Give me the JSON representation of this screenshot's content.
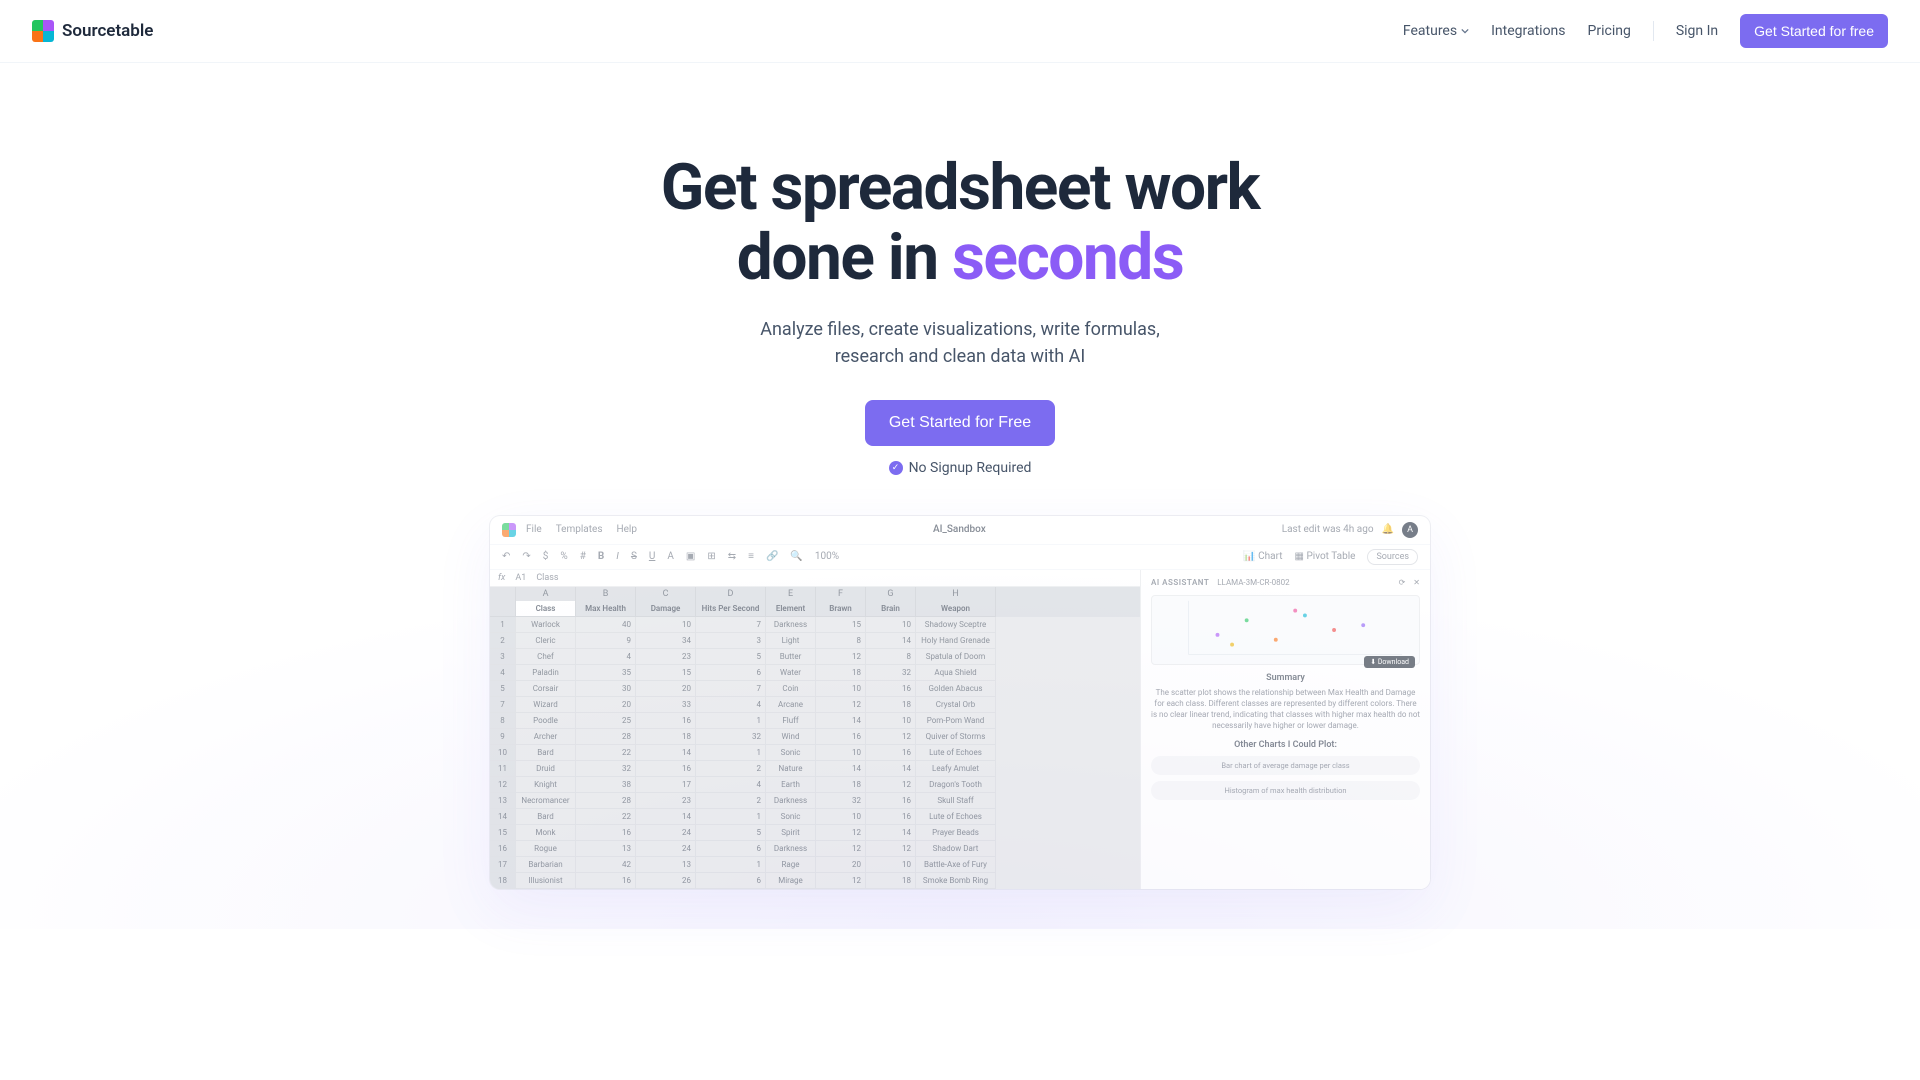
{
  "brand": "Sourcetable",
  "nav": {
    "features": "Features",
    "integrations": "Integrations",
    "pricing": "Pricing",
    "signin": "Sign In",
    "cta": "Get Started for free"
  },
  "hero": {
    "line1a": "Get spreadsheet work",
    "line2a": "done in ",
    "line2b": "seconds",
    "sub1": "Analyze files, create visualizations, write formulas,",
    "sub2": "research and clean data with AI",
    "cta": "Get Started for Free",
    "note": "No Signup Required"
  },
  "shot": {
    "menu": [
      "File",
      "Templates",
      "Help"
    ],
    "title": "AI_Sandbox",
    "lastEdit": "Last edit was 4h ago",
    "avatar": "A",
    "toolbar": {
      "zoom": "100%",
      "chartBtn": "Chart",
      "pivotBtn": "Pivot Table",
      "sourcesBtn": "Sources"
    },
    "activeCell": "A1",
    "activeVal": "Class",
    "cols": [
      "",
      "A",
      "B",
      "C",
      "D",
      "E",
      "F",
      "G",
      "H"
    ],
    "headers": [
      "",
      "Class",
      "Max Health",
      "Damage",
      "Hits Per Second",
      "Element",
      "Brawn",
      "Brain",
      "Weapon"
    ],
    "rows": [
      [
        "1",
        "Warlock",
        "40",
        "10",
        "7",
        "Darkness",
        "15",
        "10",
        "Shadowy Sceptre"
      ],
      [
        "2",
        "Cleric",
        "9",
        "34",
        "3",
        "Light",
        "8",
        "14",
        "Holy Hand Grenade"
      ],
      [
        "3",
        "Chef",
        "4",
        "23",
        "5",
        "Butter",
        "12",
        "8",
        "Spatula of Doom"
      ],
      [
        "4",
        "Paladin",
        "35",
        "15",
        "6",
        "Water",
        "18",
        "32",
        "Aqua Shield"
      ],
      [
        "5",
        "Corsair",
        "30",
        "20",
        "7",
        "Coin",
        "10",
        "16",
        "Golden Abacus"
      ],
      [
        "7",
        "Wizard",
        "20",
        "33",
        "4",
        "Arcane",
        "12",
        "18",
        "Crystal Orb"
      ],
      [
        "8",
        "Poodle",
        "25",
        "16",
        "1",
        "Fluff",
        "14",
        "10",
        "Pom-Pom Wand"
      ],
      [
        "9",
        "Archer",
        "28",
        "18",
        "32",
        "Wind",
        "16",
        "12",
        "Quiver of Storms"
      ],
      [
        "10",
        "Bard",
        "22",
        "14",
        "1",
        "Sonic",
        "10",
        "16",
        "Lute of Echoes"
      ],
      [
        "11",
        "Druid",
        "32",
        "16",
        "2",
        "Nature",
        "14",
        "14",
        "Leafy Amulet"
      ],
      [
        "12",
        "Knight",
        "38",
        "17",
        "4",
        "Earth",
        "18",
        "12",
        "Dragon's Tooth"
      ],
      [
        "13",
        "Necromancer",
        "28",
        "23",
        "2",
        "Darkness",
        "32",
        "16",
        "Skull Staff"
      ],
      [
        "14",
        "Bard",
        "22",
        "14",
        "1",
        "Sonic",
        "10",
        "16",
        "Lute of Echoes"
      ],
      [
        "15",
        "Monk",
        "16",
        "24",
        "5",
        "Spirit",
        "12",
        "14",
        "Prayer Beads"
      ],
      [
        "16",
        "Rogue",
        "13",
        "24",
        "6",
        "Darkness",
        "12",
        "12",
        "Shadow Dart"
      ],
      [
        "17",
        "Barbarian",
        "42",
        "13",
        "1",
        "Rage",
        "20",
        "10",
        "Battle-Axe of Fury"
      ],
      [
        "18",
        "Illusionist",
        "16",
        "26",
        "6",
        "Mirage",
        "12",
        "18",
        "Smoke Bomb Ring"
      ]
    ],
    "ai": {
      "label": "AI ASSISTANT",
      "model": "LLAMA-3M-CR-0802",
      "download": "Download",
      "summaryTitle": "Summary",
      "summary": "The scatter plot shows the relationship between Max Health and Damage for each class. Different classes are represented by different colors. There is no clear linear trend, indicating that classes with higher max health do not necessarily have higher or lower damage.",
      "otherTitle": "Other Charts I Could Plot:",
      "pill1": "Bar chart of average damage per class",
      "pill2": "Histogram of max health distribution"
    }
  }
}
